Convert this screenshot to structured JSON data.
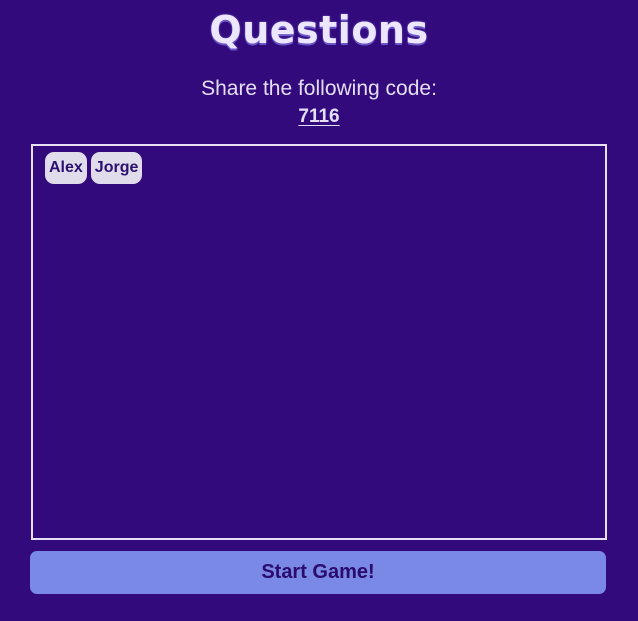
{
  "header": {
    "title": "Questions"
  },
  "share": {
    "instruction": "Share the following code:",
    "code": "7116"
  },
  "players": [
    {
      "name": "Alex"
    },
    {
      "name": "Jorge"
    }
  ],
  "actions": {
    "start_label": "Start Game!"
  },
  "colors": {
    "background": "#320a7c",
    "button": "#7b89e6",
    "chip": "#e1dcec",
    "text_light": "#e4def5"
  }
}
